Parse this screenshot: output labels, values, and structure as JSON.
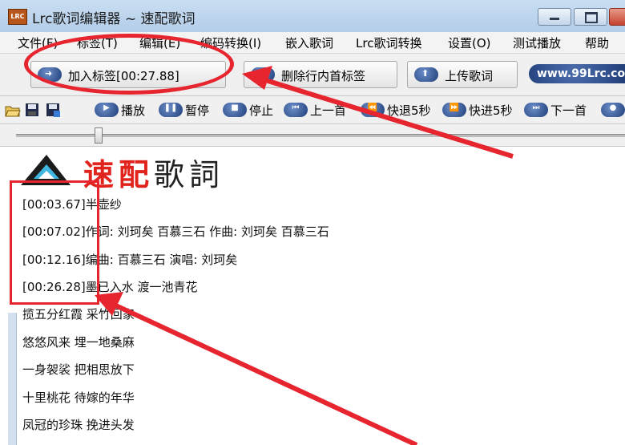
{
  "window": {
    "title": "Lrc歌词编辑器 ~ 速配歌词",
    "app_icon_text": "LRC"
  },
  "menu": [
    "文件(F)",
    "标签(T)",
    "编辑(E)",
    "编码转换(I)",
    "嵌入歌词",
    "Lrc歌词转换",
    "设置(O)",
    "测试播放",
    "帮助"
  ],
  "toolbar1": {
    "add_tag": "加入标签[00:27.88]",
    "delete_tag": "删除行内首标签",
    "upload": "上传歌词",
    "site": "www.99Lrc.co"
  },
  "toolbar2": {
    "play": "播放",
    "pause": "暂停",
    "stop": "停止",
    "prev": "上一首",
    "rewind": "快退5秒",
    "forward": "快进5秒",
    "next": "下一首"
  },
  "logo": {
    "text1": "速配",
    "text2": "歌詞"
  },
  "lyrics": [
    "[00:03.67]半壶纱",
    "[00:07.02]作词: 刘珂矣 百慕三石 作曲: 刘珂矣 百慕三石",
    "[00:12.16]编曲: 百慕三石 演唱: 刘珂矣",
    "[00:26.28]墨已入水 渡一池青花",
    "揽五分红霞 采竹回家",
    "悠悠风来 埋一地桑麻",
    "一身袈裟 把相思放下",
    "十里桃花 待嫁的年华",
    "凤冠的珍珠 挽进头发"
  ],
  "colors": {
    "annotation": "#e7252f",
    "button_pill": "#1f3f7a",
    "logo_red": "#e0231c"
  }
}
